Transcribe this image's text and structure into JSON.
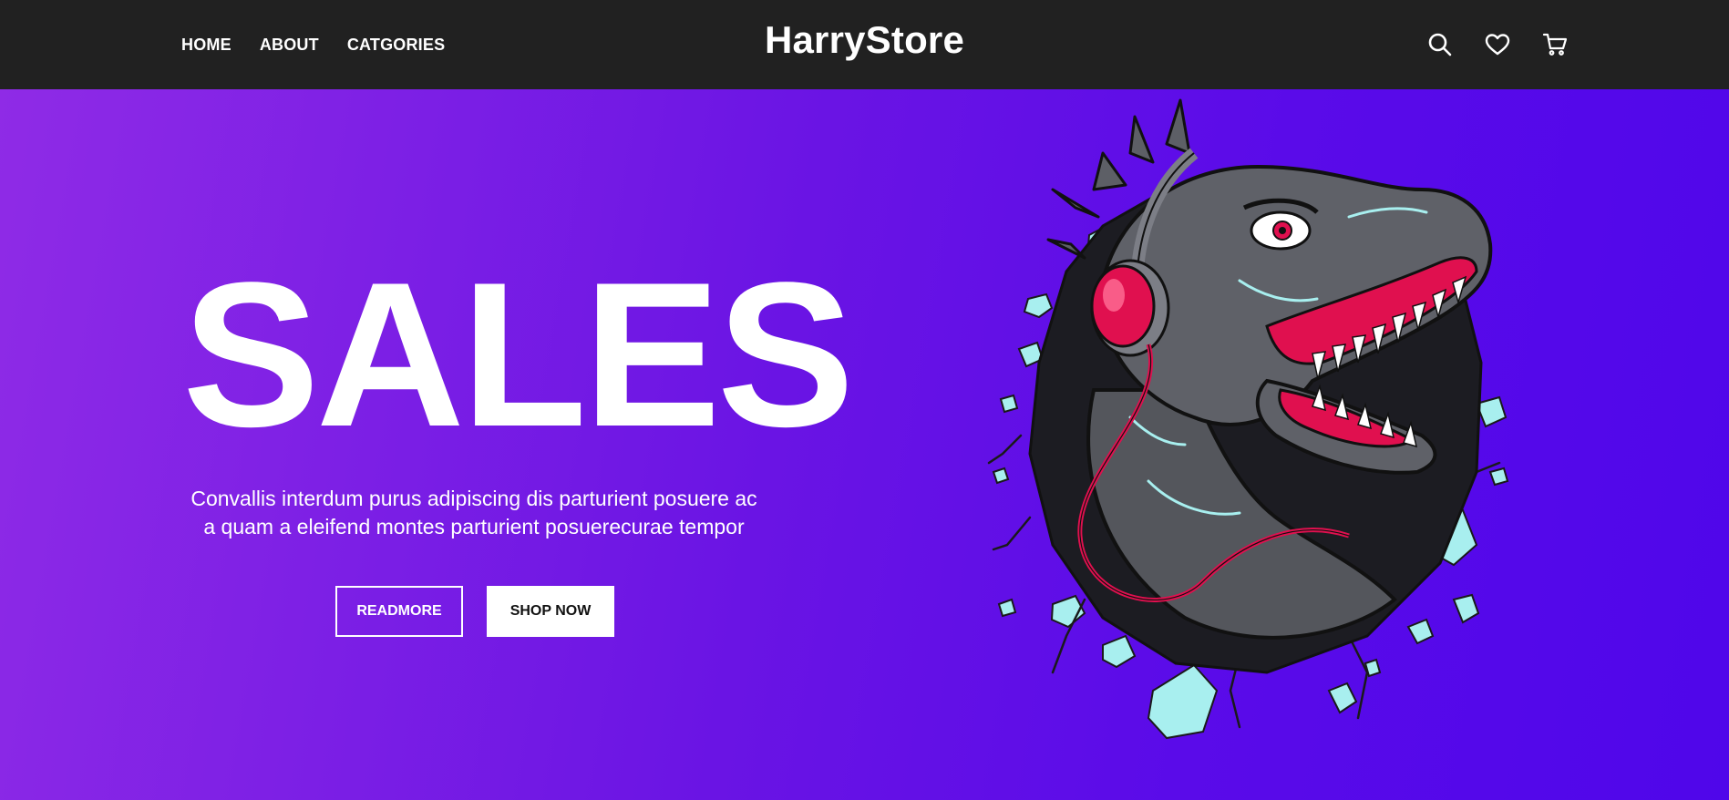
{
  "brand": {
    "name": "HarryStore"
  },
  "nav": {
    "links": [
      "HOME",
      "ABOUT",
      "CATGORIES"
    ],
    "icons": [
      "search-icon",
      "heart-icon",
      "cart-icon"
    ]
  },
  "hero": {
    "title": "SALES",
    "description": "Convallis interdum purus adipiscing dis parturient posuere ac a quam a eleifend montes parturient posuerecurae tempor",
    "buttons": {
      "readmore": "READMORE",
      "shop_now": "SHOP NOW"
    },
    "illustration": "dinosaur-with-headphones-illustration"
  },
  "colors": {
    "navbar_bg": "#212121",
    "hero_gradient_start": "#8f2be6",
    "hero_gradient_end": "#4f06ea",
    "text": "#ffffff",
    "accent_red": "#e0104f",
    "rubble": "#a8efef"
  }
}
